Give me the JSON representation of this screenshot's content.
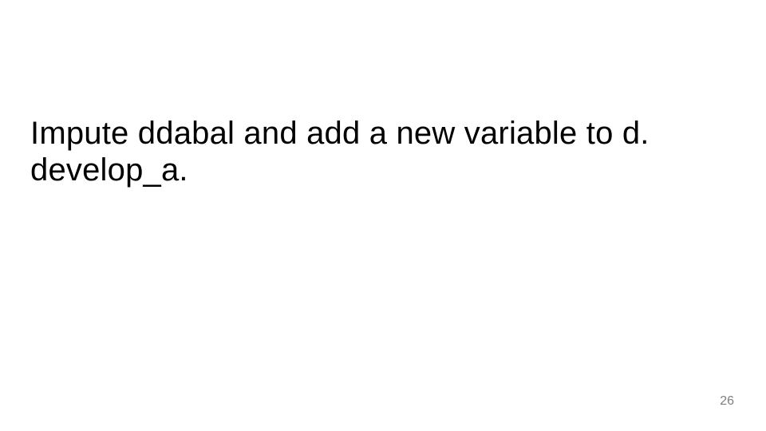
{
  "slide": {
    "title": "Impute ddabal and add a new variable to d. develop_a.",
    "page_number": "26"
  }
}
